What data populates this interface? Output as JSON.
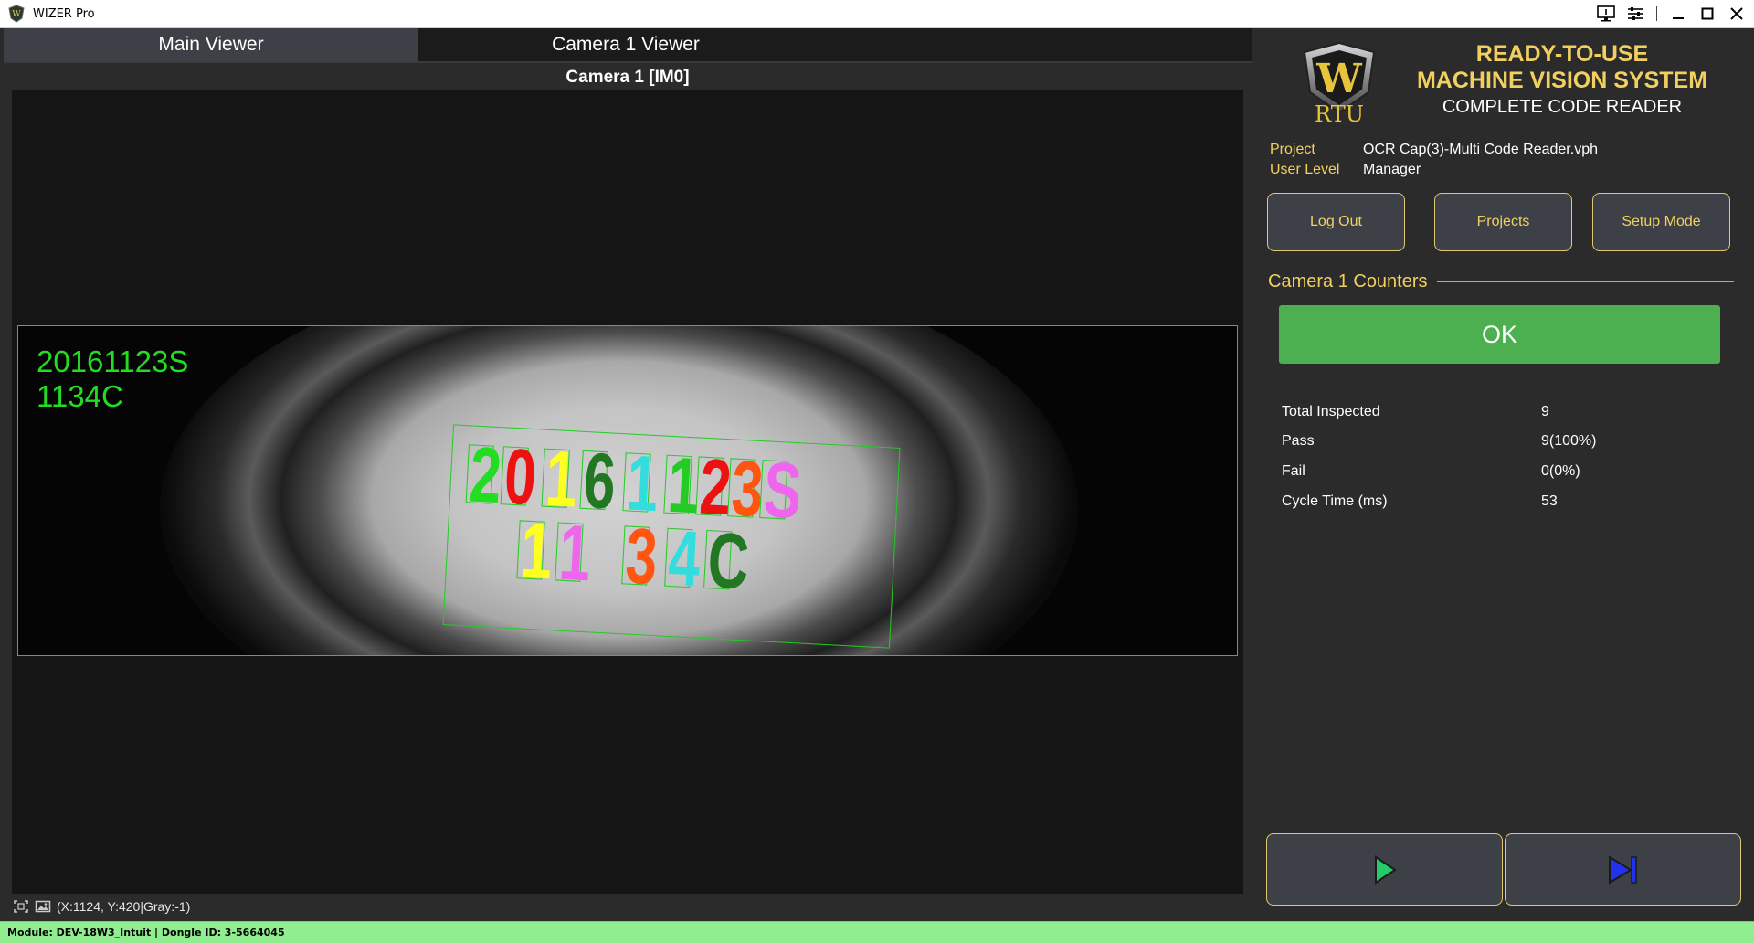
{
  "window": {
    "title": "WIZER Pro"
  },
  "tabs": [
    {
      "label": "Main Viewer",
      "active": true
    },
    {
      "label": "Camera 1 Viewer",
      "active": false
    }
  ],
  "viewer": {
    "title": "Camera 1  [IM0]",
    "ocr_lines": [
      "20161123S",
      "1134C"
    ],
    "ocr_line1_chars": [
      {
        "ch": "2",
        "color": "#22dd22"
      },
      {
        "ch": "0",
        "color": "#ee1111"
      },
      {
        "ch": "1",
        "color": "#ffff22"
      },
      {
        "ch": "6",
        "color": "#227722"
      },
      {
        "ch": "1",
        "color": "#33dddd"
      },
      {
        "ch": "1",
        "color": "#22cc22"
      },
      {
        "ch": "2",
        "color": "#ee1111"
      },
      {
        "ch": "3",
        "color": "#ff5511"
      },
      {
        "ch": "S",
        "color": "#ee66ee"
      }
    ],
    "ocr_line2_chars": [
      {
        "ch": "1",
        "color": "#ffff22"
      },
      {
        "ch": "1",
        "color": "#ee66ee"
      },
      {
        "ch": "3",
        "color": "#ff5511"
      },
      {
        "ch": "4",
        "color": "#33dddd"
      },
      {
        "ch": "C",
        "color": "#227722"
      }
    ],
    "pixel_readout": "(X:1124, Y:420|Gray:-1)"
  },
  "branding": {
    "logo_letter": "W",
    "logo_text": "RTU",
    "headline_1": "READY-TO-USE",
    "headline_2": "MACHINE VISION SYSTEM",
    "subhead": "COMPLETE CODE READER"
  },
  "info": {
    "project_label": "Project",
    "project_value": "OCR Cap(3)-Multi Code Reader.vph",
    "user_level_label": "User Level",
    "user_level_value": "Manager"
  },
  "buttons": {
    "logout": "Log Out",
    "projects": "Projects",
    "setup": "Setup Mode"
  },
  "counters": {
    "heading": "Camera 1 Counters",
    "status": "OK",
    "status_color": "#4caf50",
    "rows": [
      {
        "label": "Total Inspected",
        "value": "9"
      },
      {
        "label": "Pass",
        "value": "9(100%)"
      },
      {
        "label": "Fail",
        "value": "0(0%)"
      },
      {
        "label": "Cycle Time (ms)",
        "value": "53"
      }
    ]
  },
  "controls": {
    "run_icon": "play-icon",
    "step_icon": "step-forward-icon"
  },
  "statusbar": {
    "text": "Module: DEV-18W3_Intuit | Dongle ID: 3-5664045"
  },
  "colors": {
    "accent_gold": "#f2d060",
    "roi_green": "#22cc22",
    "statusbar_green": "#90ee90"
  }
}
